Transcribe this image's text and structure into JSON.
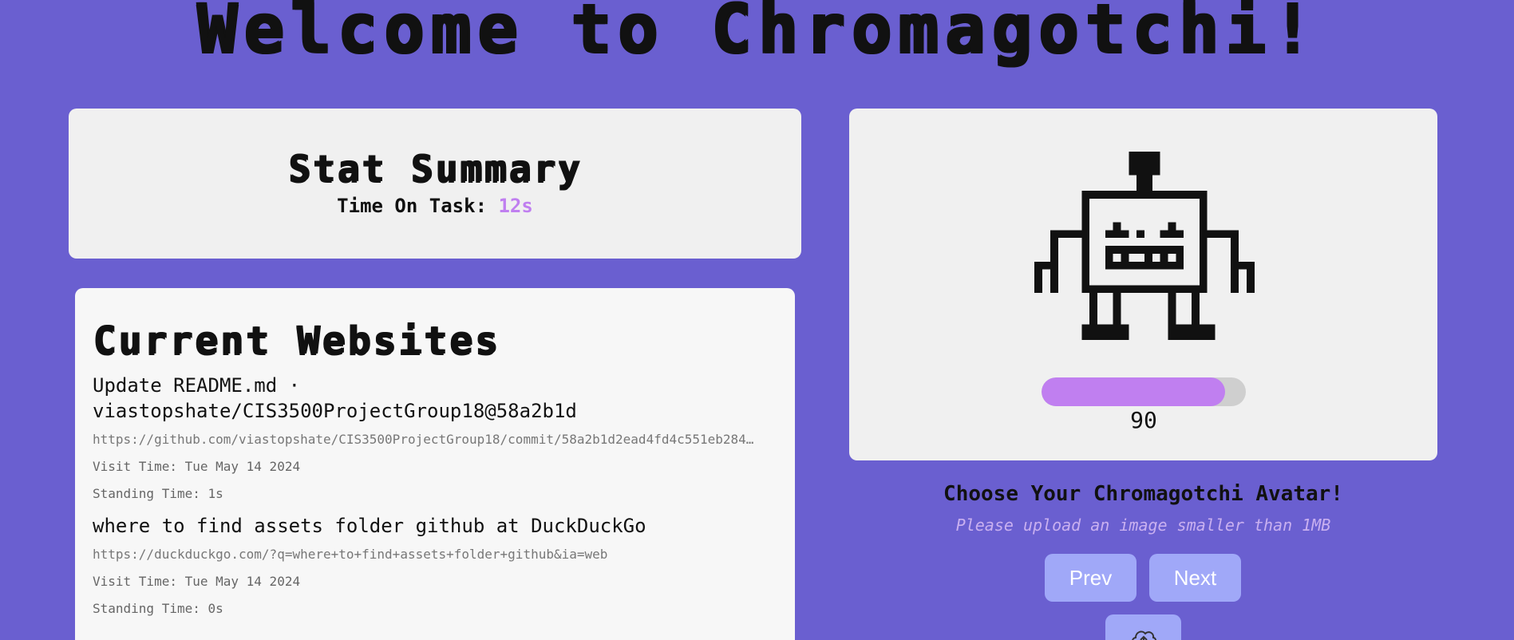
{
  "header": {
    "title": "Welcome to Chromagotchi!"
  },
  "stats": {
    "title": "Stat Summary",
    "time_label": "Time On Task: ",
    "time_value": "12s"
  },
  "websites": {
    "title": "Current Websites",
    "items": [
      {
        "title": "Update README.md · viastopshate/CIS3500ProjectGroup18@58a2b1d",
        "url": "https://github.com/viastopshate/CIS3500ProjectGroup18/commit/58a2b1d2ead4fd4c551eb284…",
        "visit": "Visit Time: Tue May 14 2024",
        "standing": "Standing Time: 1s"
      },
      {
        "title": "where to find assets folder github at DuckDuckGo",
        "url": "https://duckduckgo.com/?q=where+to+find+assets+folder+github&ia=web",
        "visit": "Visit Time: Tue May 14 2024",
        "standing": "Standing Time: 0s"
      }
    ]
  },
  "pet": {
    "icon": "robot-icon",
    "progress_percent": 90,
    "progress_label": "90",
    "progress_color": "#c07ff0"
  },
  "avatar": {
    "heading": "Choose Your Chromagotchi Avatar!",
    "subtext": "Please upload an image smaller than 1MB",
    "prev_label": "Prev",
    "next_label": "Next",
    "upload_icon": "cloud-upload-icon"
  },
  "colors": {
    "background": "#6a5fd0",
    "accent": "#c07ff0",
    "button": "#a0a8f8"
  }
}
